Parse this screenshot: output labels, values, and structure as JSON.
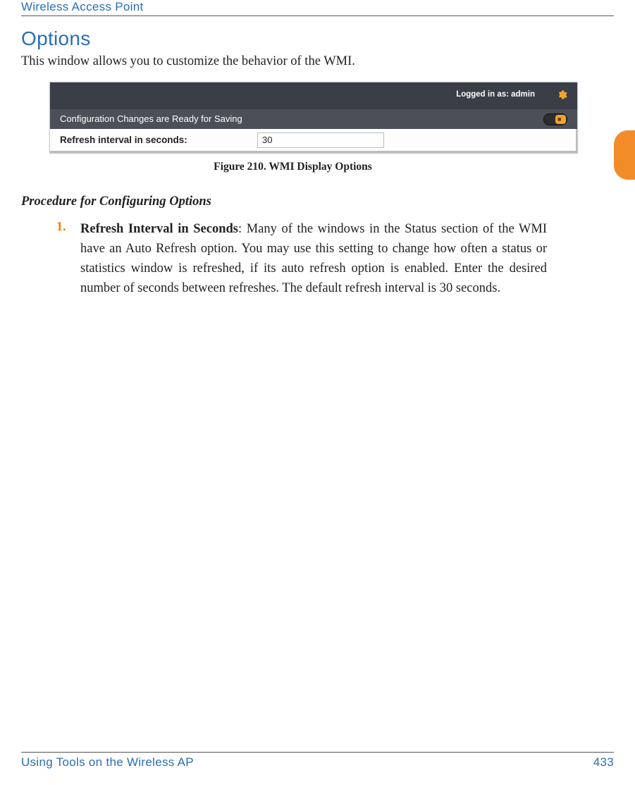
{
  "header": "Wireless Access Point",
  "section_title": "Options",
  "intro": "This window allows you to customize the behavior of the WMI.",
  "screenshot": {
    "login_label": "Logged in as: admin",
    "gear_icon": "gear-icon",
    "config_bar": "Configuration Changes are Ready for Saving",
    "row_label": "Refresh interval in seconds:",
    "row_value": "30"
  },
  "figure_caption": "Figure 210. WMI Display Options",
  "procedure_heading": "Procedure for Configuring Options",
  "list": {
    "num": "1.",
    "bold": "Refresh Interval in Seconds",
    "rest": ": Many of the windows in the Status section of the WMI have an Auto Refresh option. You may use this setting to change how often a status or statistics window is refreshed, if its auto refresh option is enabled. Enter the desired number of seconds between refreshes. The default refresh interval is 30 seconds."
  },
  "footer": {
    "left": "Using Tools on the Wireless AP",
    "page": "433"
  }
}
